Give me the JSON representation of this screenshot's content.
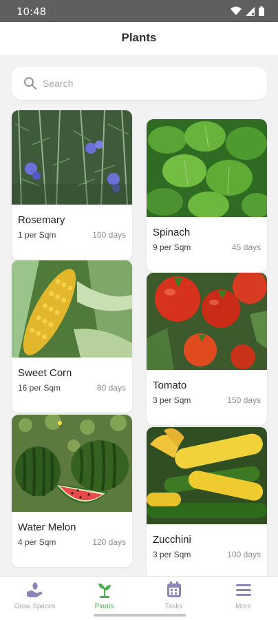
{
  "status_bar": {
    "time": "10:48"
  },
  "app_bar": {
    "title": "Plants"
  },
  "search": {
    "placeholder": "Search",
    "value": ""
  },
  "plants": [
    {
      "name": "Rosemary",
      "spacing": "1 per Sqm",
      "days": "100 days",
      "image": "rosemary-photo"
    },
    {
      "name": "Spinach",
      "spacing": "9 per Sqm",
      "days": "45 days",
      "image": "spinach-photo"
    },
    {
      "name": "Sweet Corn",
      "spacing": "16 per Sqm",
      "days": "80 days",
      "image": "corn-photo"
    },
    {
      "name": "Tomato",
      "spacing": "3 per Sqm",
      "days": "150 days",
      "image": "tomato-photo"
    },
    {
      "name": "Water Melon",
      "spacing": "4 per Sqm",
      "days": "120 days",
      "image": "watermelon-photo"
    },
    {
      "name": "Zucchini",
      "spacing": "3 per Sqm",
      "days": "100 days",
      "image": "zucchini-photo"
    }
  ],
  "bottom_nav": {
    "items": [
      {
        "label": "Grow Spaces",
        "icon": "hand-plant-icon",
        "active": false
      },
      {
        "label": "Plants",
        "icon": "sprout-icon",
        "active": true
      },
      {
        "label": "Tasks",
        "icon": "calendar-icon",
        "active": false
      },
      {
        "label": "More",
        "icon": "menu-icon",
        "active": false
      }
    ]
  },
  "colors": {
    "active": "#4caf50",
    "inactive": "#a7a7a7",
    "icon_inactive": "#8a87b8"
  }
}
